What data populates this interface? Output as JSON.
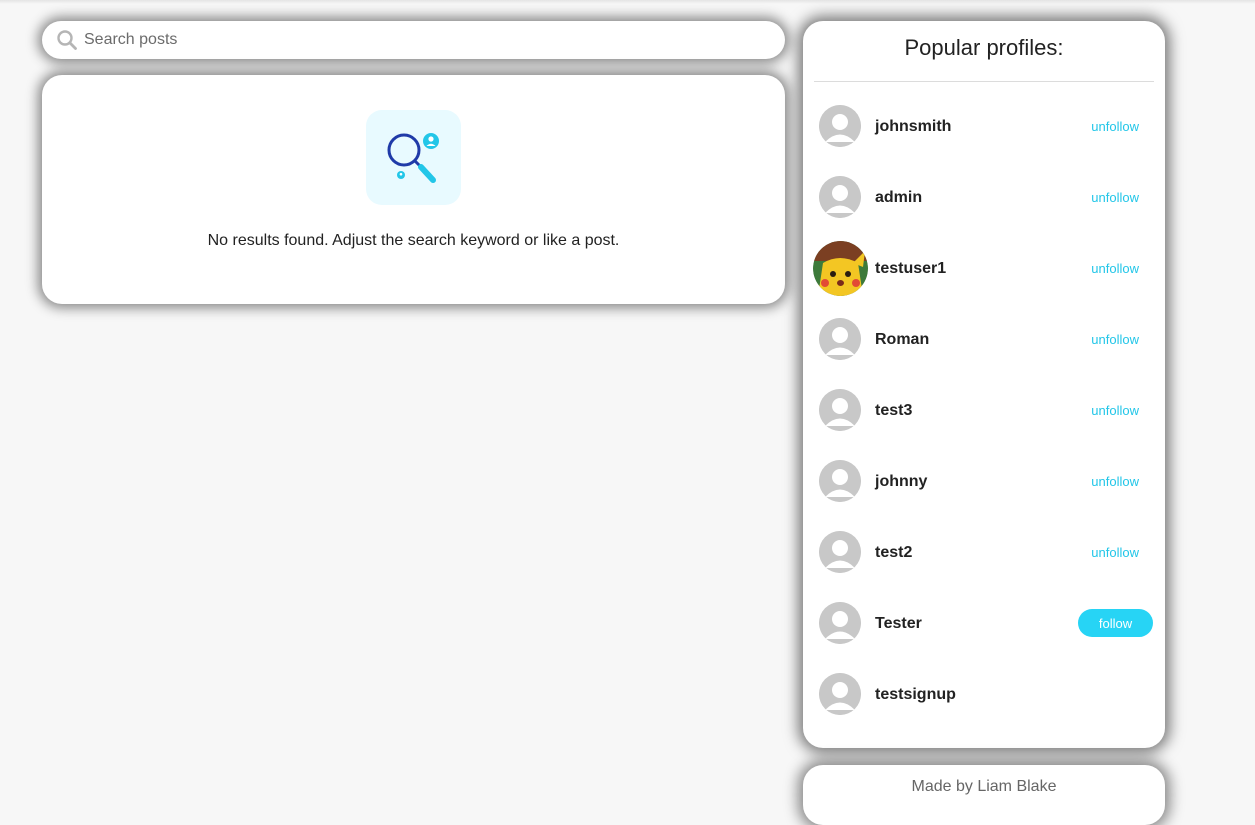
{
  "search": {
    "placeholder": "Search posts",
    "value": "",
    "icon": "search-icon"
  },
  "results": {
    "empty_message": "No results found. Adjust the search keyword or like a post.",
    "illustration_icon": "search-user-icon"
  },
  "profiles": {
    "title": "Popular profiles:",
    "items": [
      {
        "name": "johnsmith",
        "action": "unfollow",
        "avatar": "default-avatar-icon"
      },
      {
        "name": "admin",
        "action": "unfollow",
        "avatar": "default-avatar-icon"
      },
      {
        "name": "testuser1",
        "action": "unfollow",
        "avatar": "photo-avatar"
      },
      {
        "name": "Roman",
        "action": "unfollow",
        "avatar": "default-avatar-icon"
      },
      {
        "name": "test3",
        "action": "unfollow",
        "avatar": "default-avatar-icon"
      },
      {
        "name": "johnny",
        "action": "unfollow",
        "avatar": "default-avatar-icon"
      },
      {
        "name": "test2",
        "action": "unfollow",
        "avatar": "default-avatar-icon"
      },
      {
        "name": "Tester",
        "action": "follow",
        "avatar": "default-avatar-icon"
      },
      {
        "name": "testsignup",
        "action": "",
        "avatar": "default-avatar-icon"
      }
    ]
  },
  "footer": {
    "text": "Made by Liam Blake"
  },
  "colors": {
    "accent": "#27d4f5",
    "link": "#22c6e8",
    "background": "#f7f7f7"
  }
}
